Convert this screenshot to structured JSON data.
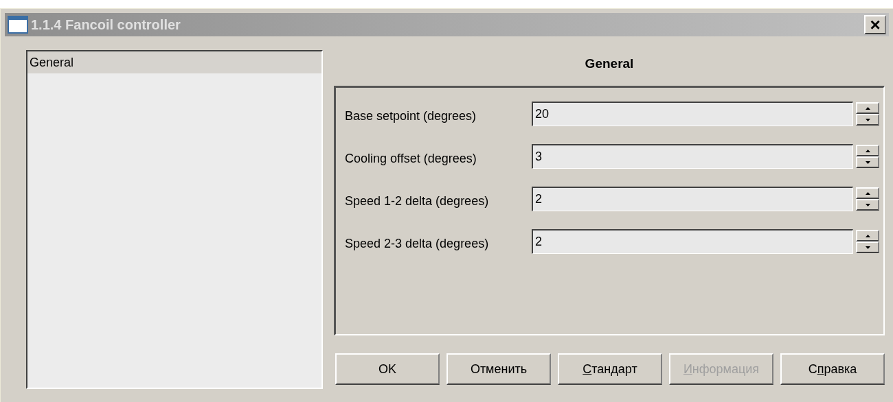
{
  "window": {
    "title": "1.1.4 Fancoil controller",
    "close": "×"
  },
  "tree": {
    "items": [
      {
        "label": "General",
        "selected": true
      }
    ]
  },
  "panel": {
    "title": "General",
    "fields": [
      {
        "label": "Base setpoint (degrees)",
        "value": "20"
      },
      {
        "label": "Cooling offset (degrees)",
        "value": "3"
      },
      {
        "label": "Speed 1-2 delta (degrees)",
        "value": "2"
      },
      {
        "label": "Speed 2-3 delta (degrees)",
        "value": "2"
      }
    ]
  },
  "buttons": [
    {
      "before": "OK",
      "disabled": false
    },
    {
      "before": "Отменить",
      "disabled": false
    },
    {
      "key": "С",
      "after": "тандарт",
      "disabled": false
    },
    {
      "key": "И",
      "after": "нформация",
      "disabled": true
    },
    {
      "before": "С",
      "key": "п",
      "after": "равка",
      "disabled": false
    }
  ]
}
